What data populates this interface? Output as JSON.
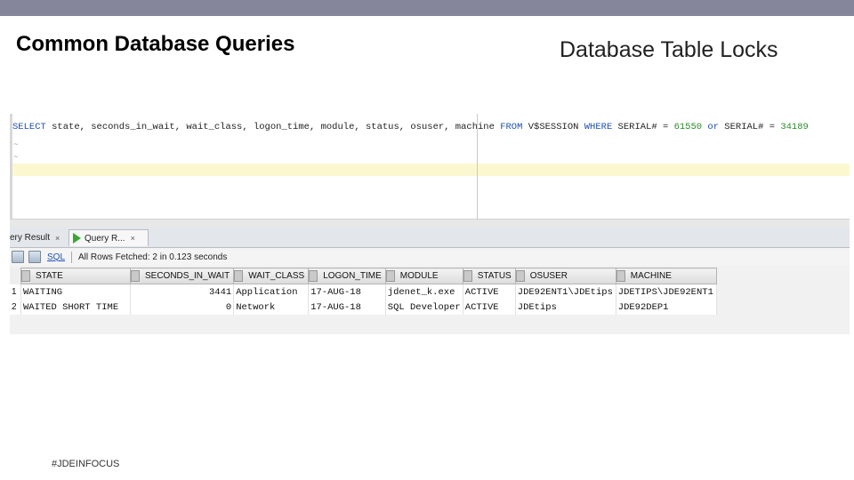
{
  "slide": {
    "left_title": "Common Database Queries",
    "right_title": "Database Table Locks",
    "footer": "#JDEINFOCUS"
  },
  "editor": {
    "query": [
      {
        "t": "SELECT",
        "k": "kw"
      },
      {
        "t": " state, seconds_in_wait, wait_class, logon_time, module, status, osuser, machine  ",
        "k": ""
      },
      {
        "t": "FROM",
        "k": "kw"
      },
      {
        "t": " V$SESSION ",
        "k": ""
      },
      {
        "t": "WHERE",
        "k": "kw"
      },
      {
        "t": " SERIAL# = ",
        "k": ""
      },
      {
        "t": "61550",
        "k": "num"
      },
      {
        "t": " ",
        "k": ""
      },
      {
        "t": "or",
        "k": "kw"
      },
      {
        "t": " SERIAL# = ",
        "k": ""
      },
      {
        "t": "34189",
        "k": "num"
      }
    ]
  },
  "results": {
    "tab_prev": "ery Result",
    "tab_current": "Query R...",
    "tab_close": "×",
    "toolbar_sql": "SQL",
    "status_text": "All Rows Fetched: 2 in 0.123 seconds",
    "columns": [
      "STATE",
      "SECONDS_IN_WAIT",
      "WAIT_CLASS",
      "LOGON_TIME",
      "MODULE",
      "STATUS",
      "OSUSER",
      "MACHINE"
    ],
    "rows": [
      {
        "num": "1",
        "cells": [
          "WAITING",
          "3441",
          "Application",
          "17-AUG-18",
          "jdenet_k.exe",
          "ACTIVE",
          "JDE92ENT1\\JDEtips",
          "JDETIPS\\JDE92ENT1"
        ]
      },
      {
        "num": "2",
        "cells": [
          "WAITED SHORT TIME",
          "0",
          "Network",
          "17-AUG-18",
          "SQL Developer",
          "ACTIVE",
          "JDEtips",
          "JDE92DEP1"
        ]
      }
    ]
  },
  "colors": {
    "top_bar": "#85859b",
    "keyword": "#1f4fb0",
    "number": "#2d8a2d",
    "highlight_line": "#fbf8d0"
  },
  "icons": [
    "play-icon",
    "save-icon",
    "refresh-icon",
    "grid-header-icon"
  ]
}
